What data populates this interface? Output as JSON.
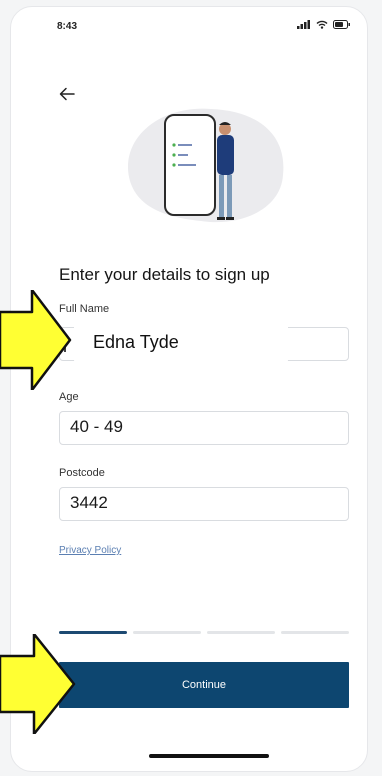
{
  "status": {
    "time": "8:43"
  },
  "page": {
    "title": "Enter your details to sign up"
  },
  "form": {
    "full_name": {
      "label": "Full Name",
      "value": "Edna Tyde"
    },
    "age": {
      "label": "Age",
      "value": "40 - 49"
    },
    "postcode": {
      "label": "Postcode",
      "value": "3442"
    }
  },
  "privacy_link": "Privacy Policy",
  "progress": {
    "steps": 4,
    "current": 1
  },
  "continue_label": "Continue",
  "icons": [
    "back-arrow-icon",
    "signal-icon",
    "wifi-icon",
    "battery-icon"
  ],
  "colors": {
    "primary": "#0d4670",
    "highlight_arrow": "#ffff33",
    "link": "#5b7fb2"
  }
}
